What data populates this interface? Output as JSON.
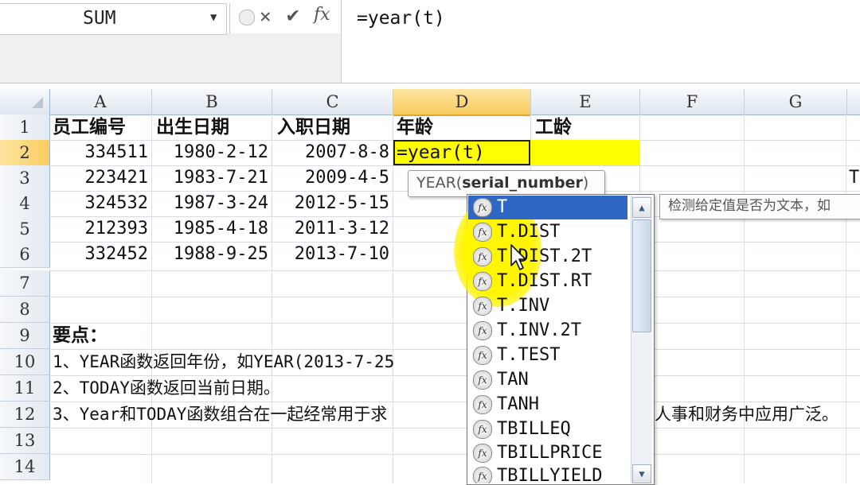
{
  "formula_bar": {
    "name_box": "SUM",
    "dropdown": "▼",
    "cancel_icon": "✕",
    "enter_icon": "✔",
    "fx_label": "fx",
    "formula": "=year(t)"
  },
  "columns": [
    "A",
    "B",
    "C",
    "D",
    "E",
    "F",
    "G"
  ],
  "rows": [
    "1",
    "2",
    "3",
    "4",
    "5",
    "6",
    "7",
    "8",
    "9",
    "10",
    "11",
    "12",
    "13",
    "14"
  ],
  "table": {
    "headers": [
      "员工编号",
      "出生日期",
      "入职日期",
      "年龄",
      "工龄"
    ],
    "data": [
      [
        "334511",
        "1980-2-12",
        "2007-8-8"
      ],
      [
        "223421",
        "1983-7-21",
        "2009-4-5"
      ],
      [
        "324532",
        "1987-3-24",
        "2012-5-15"
      ],
      [
        "212393",
        "1985-4-18",
        "2011-3-12"
      ],
      [
        "332452",
        "1988-9-25",
        "2013-7-10"
      ]
    ],
    "active_cell_text": "=year(t)",
    "g3_fragment": "T"
  },
  "notes": {
    "title": "要点：",
    "line1": "1、YEAR函数返回年份，如YEAR(2013-7-25",
    "line2": "2、TODAY函数返回当前日期。",
    "line3_left": "3、Year和TODAY函数组合在一起经常用于求",
    "line3_right": "人事和财务中应用广泛。"
  },
  "tooltip": {
    "prefix": "YEAR(",
    "arg": "serial_number",
    "suffix": ")"
  },
  "description_tip": "检测给定值是否为文本，如",
  "autocomplete": {
    "items": [
      "T",
      "T.DIST",
      "T.DIST.2T",
      "T.DIST.RT",
      "T.INV",
      "T.INV.2T",
      "T.TEST",
      "TAN",
      "TANH",
      "TBILLEQ",
      "TBILLPRICE",
      "TBILLYIELD"
    ],
    "selected_index": 0,
    "icon_glyph": "fx",
    "scroll_up": "▲",
    "scroll_down": "▼"
  }
}
